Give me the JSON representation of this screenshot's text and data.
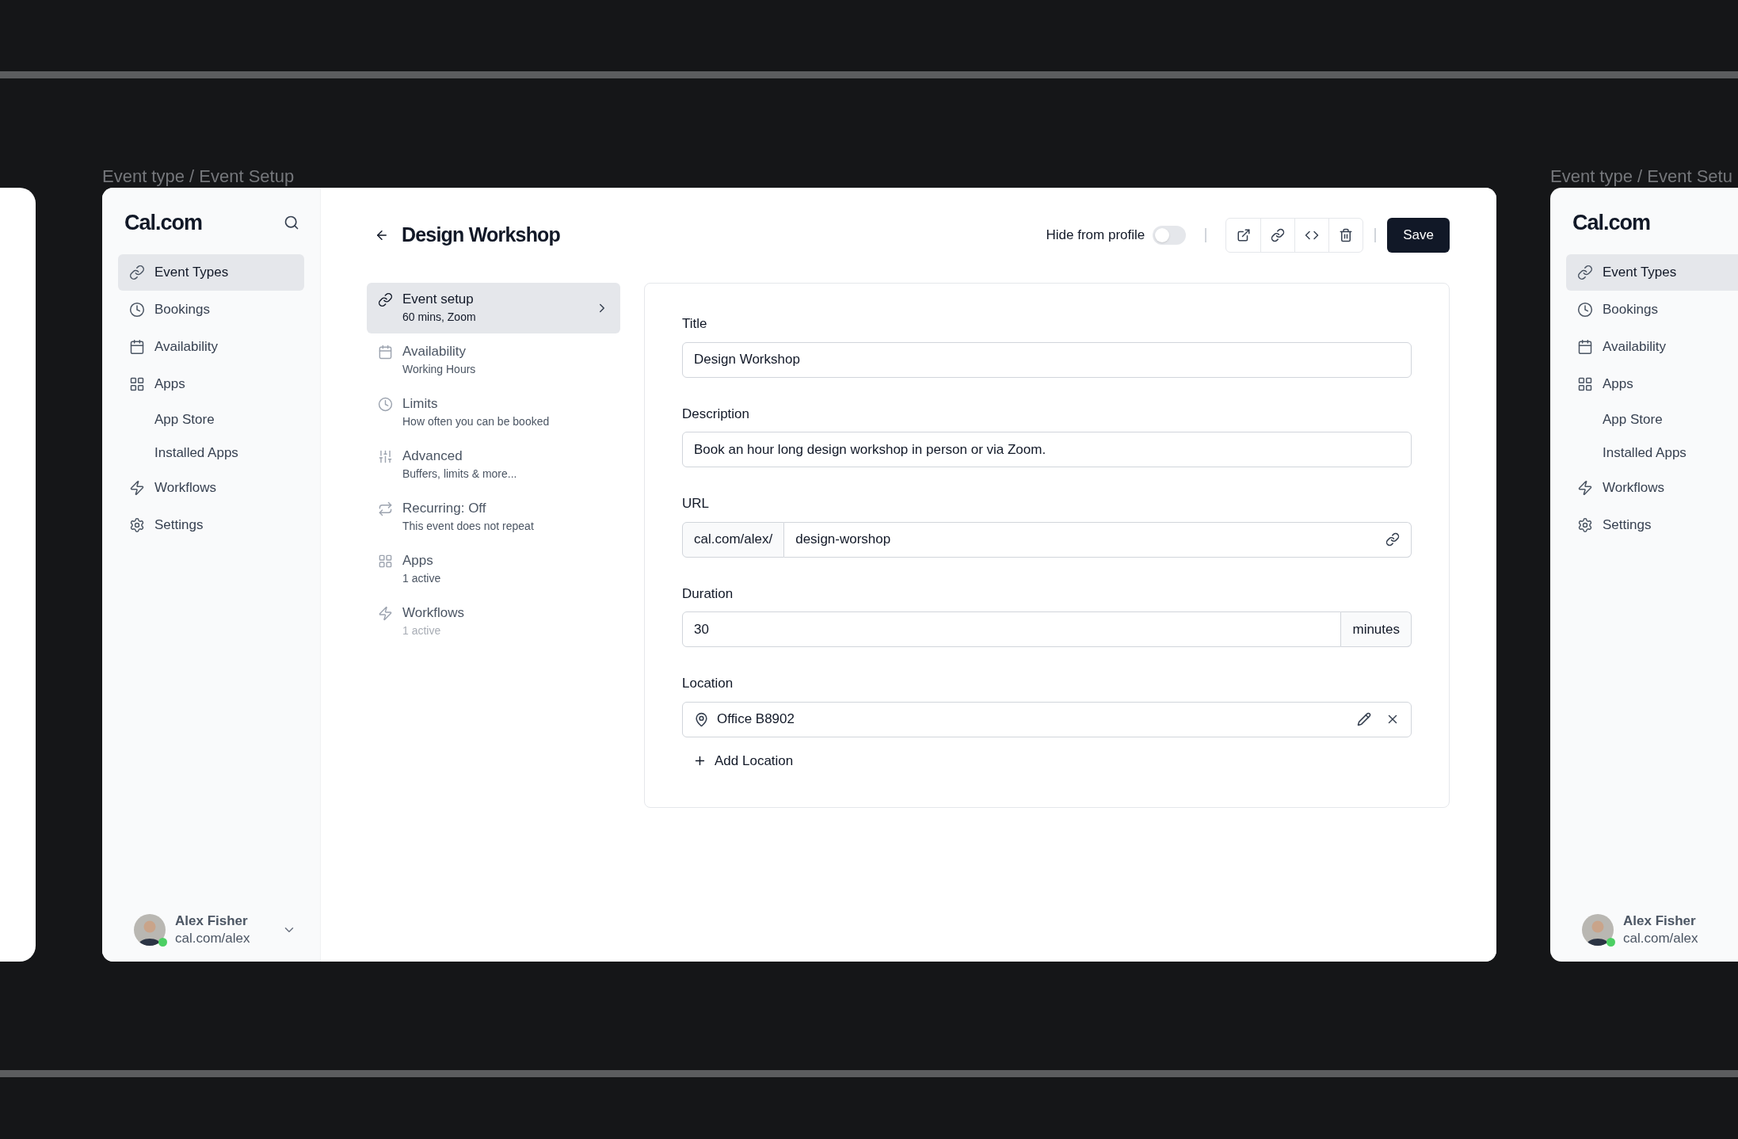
{
  "main_frame": {
    "label": "Event type / Event Setup",
    "sidebar": {
      "logo": "Cal.com",
      "items": [
        {
          "label": "Event Types",
          "kind": "link",
          "selected": true
        },
        {
          "label": "Bookings",
          "kind": "clock",
          "selected": false
        },
        {
          "label": "Availability",
          "kind": "calendar",
          "selected": false
        },
        {
          "label": "Apps",
          "kind": "grid",
          "selected": false,
          "children": [
            {
              "label": "App Store",
              "selected": false
            },
            {
              "label": "Installed Apps",
              "selected": false
            }
          ]
        },
        {
          "label": "Workflows",
          "kind": "zap",
          "selected": false
        },
        {
          "label": "Settings",
          "kind": "gear",
          "selected": false
        }
      ],
      "user": {
        "name": "Alex Fisher",
        "handle": "cal.com/alex",
        "online": true
      }
    },
    "header": {
      "title": "Design Workshop",
      "hide_from_profile": {
        "label": "Hide from profile",
        "on": false
      },
      "actions": [
        {
          "kind": "external"
        },
        {
          "kind": "link"
        },
        {
          "kind": "code"
        },
        {
          "kind": "delete"
        }
      ],
      "save": "Save"
    },
    "setup_nav": [
      {
        "title": "Event setup",
        "subtitle": "60 mins, Zoom",
        "kind": "link",
        "selected": true,
        "dimmed": false
      },
      {
        "title": "Availability",
        "subtitle": "Working Hours",
        "kind": "calendar",
        "selected": false,
        "dimmed": false
      },
      {
        "title": "Limits",
        "subtitle": "How often you can be booked",
        "kind": "clock",
        "selected": false,
        "dimmed": false
      },
      {
        "title": "Advanced",
        "subtitle": "Buffers, limits & more...",
        "kind": "sliders",
        "selected": false,
        "dimmed": false
      },
      {
        "title": "Recurring: Off",
        "subtitle": "This event does not repeat",
        "kind": "repeat",
        "selected": false,
        "dimmed": false
      },
      {
        "title": "Apps",
        "subtitle": "1 active",
        "kind": "grid",
        "selected": false,
        "dimmed": false
      },
      {
        "title": "Workflows",
        "subtitle": "1 active",
        "kind": "zap",
        "selected": false,
        "dimmed": true
      }
    ],
    "form": {
      "title": {
        "label": "Title",
        "value": "Design Workshop"
      },
      "description": {
        "label": "Description",
        "value": "Book an hour long design workshop in person or via Zoom."
      },
      "url": {
        "label": "URL",
        "prefix": "cal.com/alex/",
        "value": "design-worshop"
      },
      "duration": {
        "label": "Duration",
        "value": "30",
        "unit": "minutes"
      },
      "location": {
        "label": "Location",
        "value": "Office B8902"
      },
      "add_location": "Add Location"
    }
  },
  "side_frame": {
    "label": "Event type / Event Setu",
    "sidebar": {
      "logo": "Cal.com",
      "items": [
        {
          "label": "Event Types",
          "kind": "link",
          "selected": true
        },
        {
          "label": "Bookings",
          "kind": "clock",
          "selected": false
        },
        {
          "label": "Availability",
          "kind": "calendar",
          "selected": false
        },
        {
          "label": "Apps",
          "kind": "grid",
          "selected": false,
          "children": [
            {
              "label": "App Store",
              "selected": false
            },
            {
              "label": "Installed Apps",
              "selected": false
            }
          ]
        },
        {
          "label": "Workflows",
          "kind": "zap",
          "selected": false
        },
        {
          "label": "Settings",
          "kind": "gear",
          "selected": false
        }
      ],
      "user": {
        "name": "Alex Fisher",
        "handle": "cal.com/alex",
        "online": true
      }
    }
  }
}
